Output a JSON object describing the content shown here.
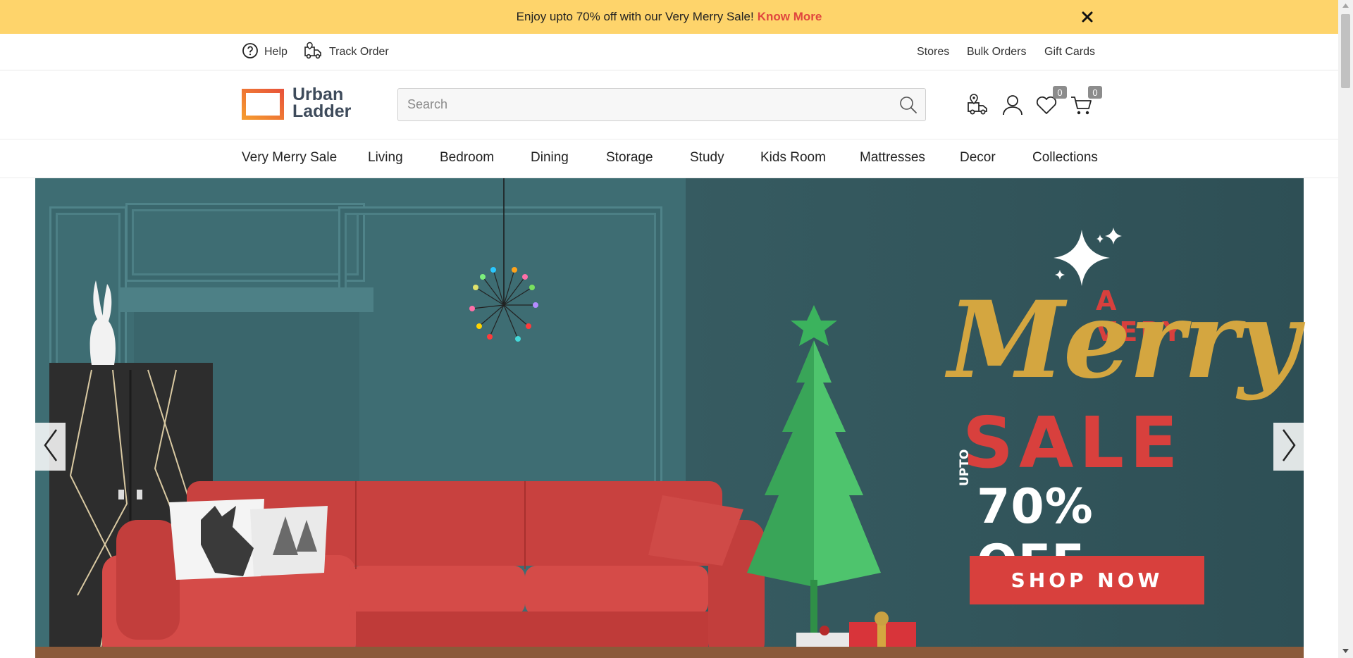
{
  "promo": {
    "text": "Enjoy upto 70% off with our Very Merry Sale!",
    "link": "Know More",
    "close_icon": "close-icon"
  },
  "utility": {
    "help": "Help",
    "track_order": "Track Order",
    "stores": "Stores",
    "bulk_orders": "Bulk Orders",
    "gift_cards": "Gift Cards"
  },
  "header": {
    "logo_line1": "Urban",
    "logo_line2": "Ladder",
    "search_placeholder": "Search",
    "wishlist_count": "0",
    "cart_count": "0"
  },
  "nav": {
    "items": [
      "Very Merry Sale",
      "Living",
      "Bedroom",
      "Dining",
      "Storage",
      "Study",
      "Kids Room",
      "Mattresses",
      "Decor",
      "Collections"
    ]
  },
  "hero": {
    "line1": "A VERY",
    "line2": "Merry",
    "line3": "SALE",
    "upto": "UPTO",
    "discount": "70% OFF",
    "cta": "SHOP NOW"
  },
  "colors": {
    "promo_bg": "#fed46b",
    "accent_red": "#d8403d",
    "gold": "#d4a640",
    "teal_wall": "#3e6d73"
  }
}
